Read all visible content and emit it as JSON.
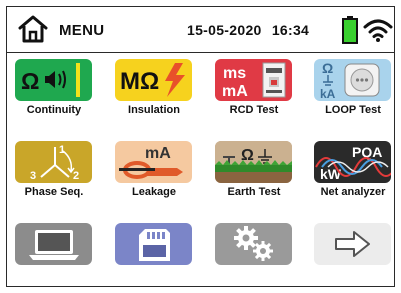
{
  "header": {
    "title": "MENU",
    "date": "15-05-2020",
    "time": "16:34"
  },
  "tiles": [
    {
      "label": "Continuity",
      "icon": "omega-sound-icon",
      "color": "#1fa84f"
    },
    {
      "label": "Insulation",
      "icon": "megaohm-lightning-icon",
      "color": "#f6d21e"
    },
    {
      "label": "RCD Test",
      "icon": "rcd-breaker-icon",
      "color": "#e03a45"
    },
    {
      "label": "LOOP Test",
      "icon": "loop-socket-icon",
      "color": "#a9d3ec"
    },
    {
      "label": "Phase Seq.",
      "icon": "phase-rotation-icon",
      "color": "#c9a629"
    },
    {
      "label": "Leakage",
      "icon": "clamp-meter-icon",
      "color": "#f5c9a0"
    },
    {
      "label": "Earth Test",
      "icon": "earth-ground-icon",
      "color": "#c3a07a"
    },
    {
      "label": "Net analyzer",
      "icon": "power-quality-icon",
      "color": "#2a2a2a"
    },
    {
      "label": "",
      "icon": "laptop-icon",
      "color": "#8c8c8c"
    },
    {
      "label": "",
      "icon": "memory-card-icon",
      "color": "#7b85c8"
    },
    {
      "label": "",
      "icon": "gears-icon",
      "color": "#9a9a9a"
    },
    {
      "label": "",
      "icon": "arrow-right-icon",
      "color": "#ececec"
    }
  ],
  "tile_texts": {
    "continuity_symbol": "Ω",
    "insulation_symbol": "MΩ",
    "rcd_ms": "ms",
    "rcd_ma": "mA",
    "loop_omega": "Ω",
    "loop_ka": "kA",
    "phase_1": "1",
    "phase_2": "2",
    "phase_3": "3",
    "leakage_ma": "mA",
    "earth_omega": "Ω",
    "net_pqa": "PQA",
    "net_kw": "kW"
  }
}
